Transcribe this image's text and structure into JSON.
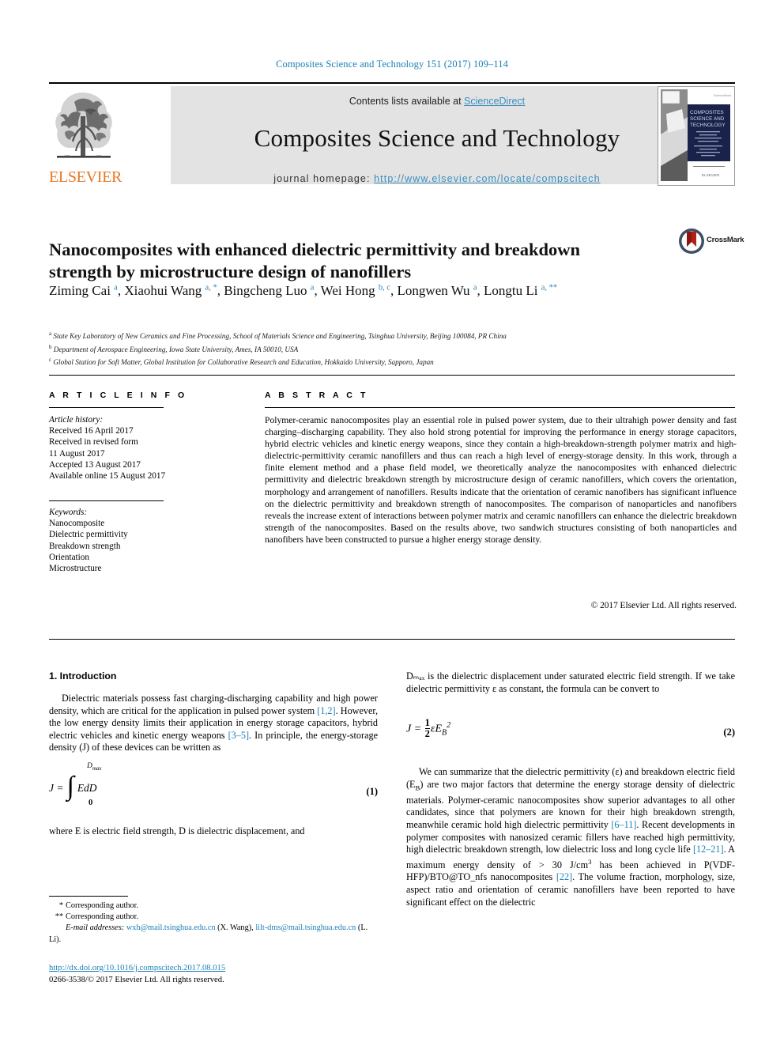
{
  "running_head": "Composites Science and Technology 151 (2017) 109–114",
  "masthead": {
    "contents_prefix": "Contents lists available at ",
    "sciencedirect": "ScienceDirect",
    "journal_title": "Composites Science and Technology",
    "homepage_prefix": "journal homepage: ",
    "homepage_url": "http://www.elsevier.com/locate/compscitech",
    "publisher": "ELSEVIER",
    "cover_title": "COMPOSITES SCIENCE AND TECHNOLOGY",
    "link_color": "#3a8fbf",
    "band_color": "#e3e3e3",
    "publisher_color": "#E87722"
  },
  "article": {
    "title": "Nanocomposites with enhanced dielectric permittivity and breakdown strength by microstructure design of nanofillers",
    "crossmark_label": "CrossMark",
    "authors_html": "Ziming Cai <sup>a</sup>, Xiaohui Wang <sup>a, *</sup>, Bingcheng Luo <sup>a</sup>, Wei Hong <sup>b, c</sup>, Longwen Wu <sup>a</sup>, Longtu Li <sup>a, **</sup>",
    "affiliations": [
      {
        "mark": "a",
        "text": "State Key Laboratory of New Ceramics and Fine Processing, School of Materials Science and Engineering, Tsinghua University, Beijing 100084, PR China"
      },
      {
        "mark": "b",
        "text": "Department of Aerospace Engineering, Iowa State University, Ames, IA 50010, USA"
      },
      {
        "mark": "c",
        "text": "Global Station for Soft Matter, Global Institution for Collaborative Research and Education, Hokkaido University, Sapporo, Japan"
      }
    ]
  },
  "article_info": {
    "heading": "A R T I C L E   I N F O",
    "history_label": "Article history:",
    "history": [
      "Received 16 April 2017",
      "Received in revised form",
      "11 August 2017",
      "Accepted 13 August 2017",
      "Available online 15 August 2017"
    ],
    "keywords_label": "Keywords:",
    "keywords": [
      "Nanocomposite",
      "Dielectric permittivity",
      "Breakdown strength",
      "Orientation",
      "Microstructure"
    ]
  },
  "abstract": {
    "heading": "A B S T R A C T",
    "text": "Polymer-ceramic nanocomposites play an essential role in pulsed power system, due to their ultrahigh power density and fast charging–discharging capability. They also hold strong potential for improving the performance in energy storage capacitors, hybrid electric vehicles and kinetic energy weapons, since they contain a high-breakdown-strength polymer matrix and high-dielectric-permittivity ceramic nanofillers and thus can reach a high level of energy-storage density. In this work, through a finite element method and a phase field model, we theoretically analyze the nanocomposites with enhanced dielectric permittivity and dielectric breakdown strength by microstructure design of ceramic nanofillers, which covers the orientation, morphology and arrangement of nanofillers. Results indicate that the orientation of ceramic nanofibers has significant influence on the dielectric permittivity and breakdown strength of nanocomposites. The comparison of nanoparticles and nanofibers reveals the increase extent of interactions between polymer matrix and ceramic nanofillers can enhance the dielectric breakdown strength of the nanocomposites. Based on the results above, two sandwich structures consisting of both nanoparticles and nanofibers have been constructed to pursue a higher energy storage density.",
    "copyright": "© 2017 Elsevier Ltd. All rights reserved."
  },
  "body": {
    "section_heading": "1. Introduction",
    "left_para_1_a": "Dielectric materials possess fast charging-discharging capability and high power density, which are critical for the application in pulsed power system ",
    "left_cite_1": "[1,2]",
    "left_para_1_b": ". However, the low energy density limits their application in energy storage capacitors, hybrid electric vehicles and kinetic energy weapons ",
    "left_cite_2": "[3–5]",
    "left_para_1_c": ". In principle, the energy-storage density (J) of these devices can be written as",
    "eq1_lhs": "J =",
    "eq1_upper": "D",
    "eq1_upper_sub": "max",
    "eq1_lower": "0",
    "eq1_body": "EdD",
    "eq1_num": "(1)",
    "left_para_2": "where E is electric field strength, D is dielectric displacement, and",
    "right_para_1": "Dₘₐₓ is the dielectric displacement under saturated electric field strength. If we take dielectric permittivity ε as constant, the formula can be convert to",
    "eq2_lhs": "J =",
    "eq2_num_top": "1",
    "eq2_num_bot": "2",
    "eq2_rhs": "εE",
    "eq2_sub": "B",
    "eq2_sup": "2",
    "eq2_num": "(2)",
    "right_para_2_a": "We can summarize that the dielectric permittivity (ε) and breakdown electric field (E",
    "right_para_2_b": ") are two major factors that determine the energy storage density of dielectric materials. Polymer-ceramic nanocomposites show superior advantages to all other candidates, since that polymers are known for their high breakdown strength, meanwhile ceramic hold high dielectric permittivity ",
    "right_cite_1": "[6–11]",
    "right_para_2_c": ". Recent developments in polymer composites with nanosized ceramic fillers have reached high permittivity, high dielectric breakdown strength, low dielectric loss and long cycle life ",
    "right_cite_2": "[12–21]",
    "right_para_2_d": ". A maximum energy density of > 30 J/cm",
    "right_para_2_e": " has been achieved in P(VDF-HFP)/BTO@TO_nfs nanocomposites ",
    "right_cite_3": "[22]",
    "right_para_2_f": ". The volume fraction, morphology, size, aspect ratio and orientation of ceramic nanofillers have been reported to have significant effect on the dielectric",
    "cite_color": "#1a7fb5"
  },
  "footer": {
    "corresponding_1_mark": "*",
    "corresponding_1": "Corresponding author.",
    "corresponding_2_mark": "**",
    "corresponding_2": "Corresponding author.",
    "email_label": "E-mail addresses:",
    "email_1": "wxh@mail.tsinghua.edu.cn",
    "email_1_owner": "(X. Wang),",
    "email_2": "lilt-dms@mail.tsinghua.edu.cn",
    "email_2_owner": "(L. Li).",
    "doi": "http://dx.doi.org/10.1016/j.compscitech.2017.08.015",
    "issn_line": "0266-3538/© 2017 Elsevier Ltd. All rights reserved."
  }
}
